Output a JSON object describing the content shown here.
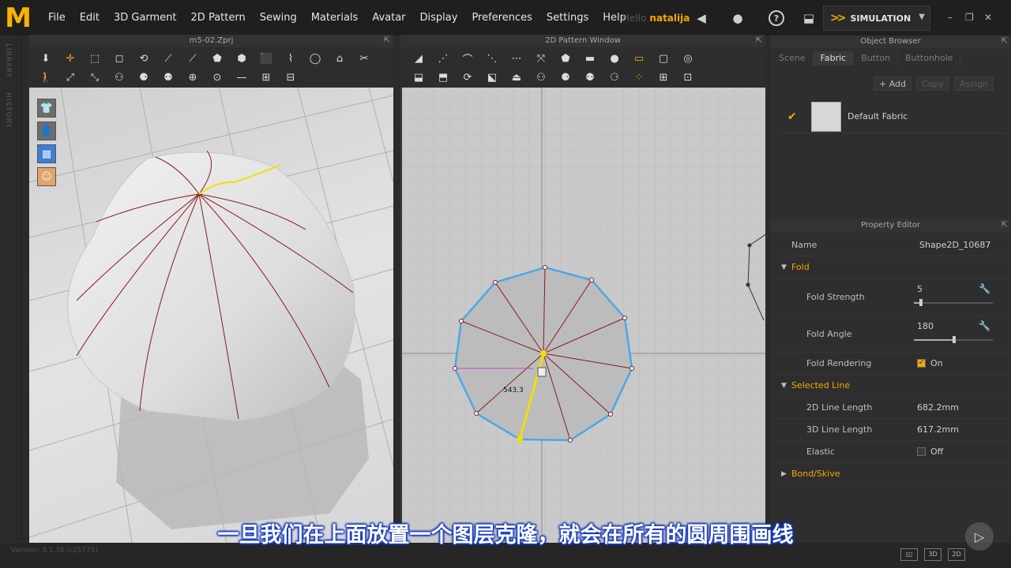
{
  "app": {
    "logo": "M",
    "menu": [
      "File",
      "Edit",
      "3D Garment",
      "2D Pattern",
      "Sewing",
      "Materials",
      "Avatar",
      "Display",
      "Preferences",
      "Settings",
      "Help"
    ],
    "user_hello": "Hello",
    "username": "natalija",
    "simulation_label": "SIMULATION"
  },
  "side_tabs": [
    "LIBRARY",
    "HISTORY"
  ],
  "windows": {
    "view3d_title": "m5-02.Zprj",
    "view2d_title": "2D Pattern Window"
  },
  "view2d": {
    "measure_label": "543.3"
  },
  "object_browser": {
    "title": "Object Browser",
    "tabs": [
      "Scene",
      "Fabric",
      "Button",
      "Buttonhole"
    ],
    "active_tab": "Fabric",
    "actions": {
      "add": "Add",
      "copy": "Copy",
      "assign": "Assign"
    },
    "fabric_name": "Default Fabric"
  },
  "property_editor": {
    "title": "Property Editor",
    "name_label": "Name",
    "name_value": "Shape2D_10687",
    "fold_section": "Fold",
    "fold_strength_label": "Fold Strength",
    "fold_strength_value": "5",
    "fold_angle_label": "Fold Angle",
    "fold_angle_value": "180",
    "fold_rendering_label": "Fold Rendering",
    "fold_rendering_value": "On",
    "selected_line_section": "Selected Line",
    "line2d_label": "2D Line Length",
    "line2d_value": "682.2mm",
    "line3d_label": "3D Line Length",
    "line3d_value": "617.2mm",
    "elastic_label": "Elastic",
    "elastic_value": "Off",
    "bond_section": "Bond/Skive"
  },
  "status": {
    "version": "Version: 3.1.38 (r25775)",
    "view_modes": [
      "3D",
      "2D"
    ]
  },
  "subtitle": "一旦我们在上面放置一个图层克隆，就会在所有的圆周围画线",
  "colors": {
    "accent": "#f2a900",
    "pattern_outline": "#4aa8e8",
    "seam": "#8a1a1a",
    "selection": "#f0e000"
  }
}
